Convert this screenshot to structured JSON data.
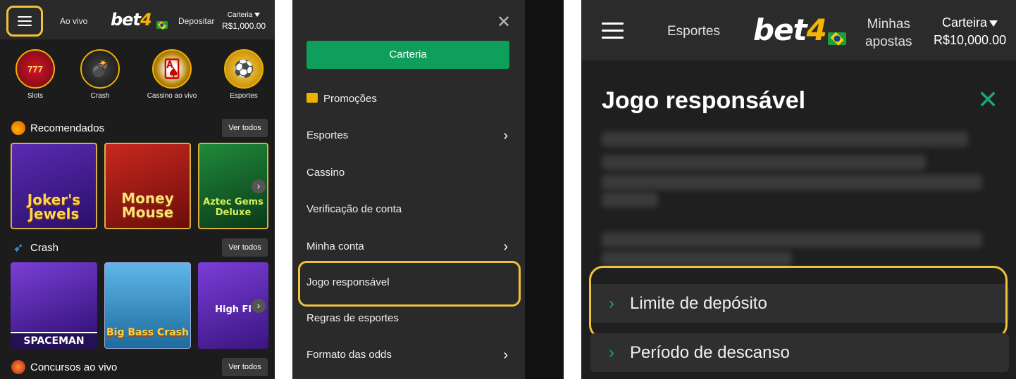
{
  "panel1": {
    "nav_live": "Ao vivo",
    "logo_text": "bet",
    "logo_digit": "4",
    "deposit": "Depositar",
    "wallet_label": "Carteria",
    "wallet_amount": "R$1,000.00",
    "categories": [
      {
        "label": "Slots",
        "icon": "slots-777-icon",
        "glyph": "777"
      },
      {
        "label": "Crash",
        "icon": "rocket-bomb-icon",
        "glyph": "💣"
      },
      {
        "label": "Cassino ao vivo",
        "icon": "roulette-cards-icon",
        "glyph": "🂡"
      },
      {
        "label": "Esportes",
        "icon": "soccer-ball-icon",
        "glyph": "⚽"
      }
    ],
    "sections": [
      {
        "title": "Recomendados",
        "button": "Ver todos",
        "icon": "fire-ball-icon",
        "games": [
          "Joker's Jewels",
          "Money Mouse",
          "Aztec Gems Deluxe"
        ]
      },
      {
        "title": "Crash",
        "button": "Ver todos",
        "icon": "rocket-icon",
        "games": [
          "SPACEMAN",
          "Big Bass Crash",
          "High Fl"
        ]
      },
      {
        "title": "Concursos ao vivo",
        "button": "Ver todos",
        "icon": "trophy-icon",
        "games": []
      }
    ]
  },
  "panel2": {
    "close": "✕",
    "wallet_button": "Carteria",
    "items": [
      {
        "label": "Promoções",
        "icon": "gift-icon",
        "chevron": false
      },
      {
        "label": "Esportes",
        "chevron": true
      },
      {
        "label": "Cassino",
        "chevron": false
      },
      {
        "label": "Verificação de conta",
        "chevron": false
      },
      {
        "label": "Minha conta",
        "chevron": true
      },
      {
        "label": "Jogo responsável",
        "chevron": false
      },
      {
        "label": "Regras de esportes",
        "chevron": false
      },
      {
        "label": "Formato das odds",
        "chevron": true
      }
    ],
    "chevron_glyph": "›"
  },
  "panel3": {
    "nav_sports": "Esportes",
    "logo_text": "bet",
    "logo_digit": "4",
    "my_bets_line1": "Minhas",
    "my_bets_line2": "apostas",
    "wallet_label": "Carteira",
    "wallet_amount": "R$10,000.00",
    "title": "Jogo responsável",
    "close": "✕",
    "accordions": [
      {
        "label": "Limite de depósito",
        "chevron": "›"
      },
      {
        "label": "Período de descanso",
        "chevron": "›"
      }
    ]
  },
  "colors": {
    "accent_green": "#0f9f5d",
    "highlight_yellow": "#f0c23a",
    "brand_gold": "#f5b400"
  }
}
